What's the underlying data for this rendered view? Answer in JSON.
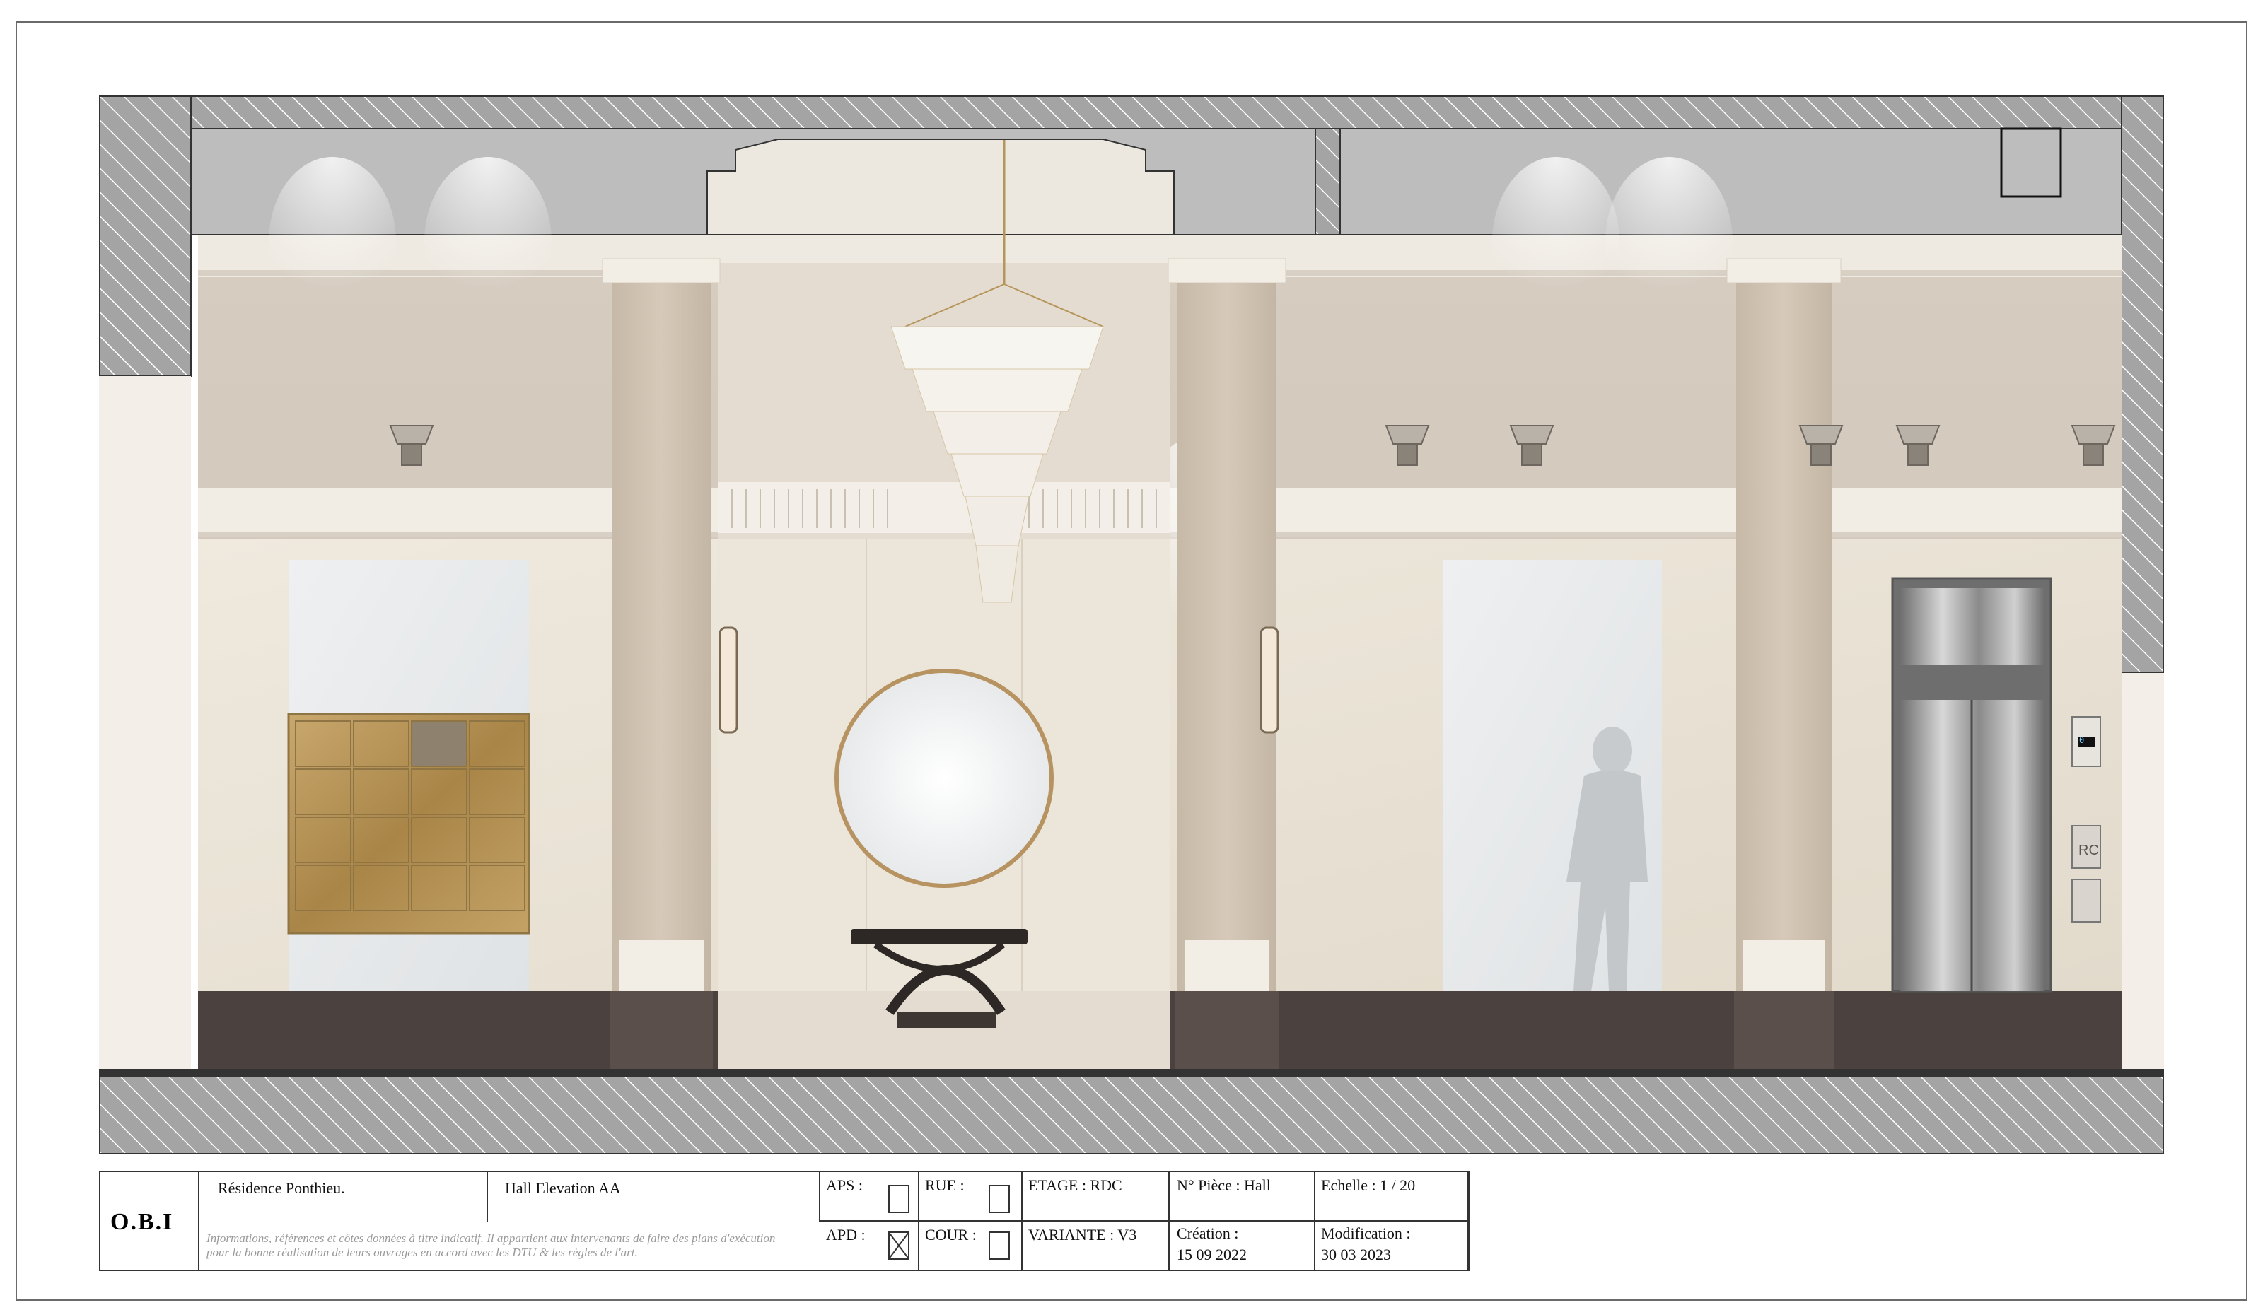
{
  "title_block": {
    "logo": "O.B.I",
    "project": "Résidence Ponthieu.",
    "drawing_name": "Hall Elevation AA",
    "disclaimer": "Informations, références et côtes données à titre indicatif. Il appartient aux  intervenants de faire des plans d'exécution pour la bonne réalisation de leurs ouvrages en accord avec les DTU & les règles de l'art.",
    "aps_label": "APS :",
    "apd_label": "APD :",
    "rue_label": "RUE :",
    "cour_label": "COUR :",
    "etage": "ETAGE : RDC",
    "variante": "VARIANTE : V3",
    "piece": "N° Pièce : Hall",
    "creation_label": "Création :",
    "creation_date": "15 09 2022",
    "echelle": "Echelle : 1 / 20",
    "modification_label": "Modification :",
    "modification_date": "30 03 2023",
    "apd_checked": true,
    "aps_checked": false,
    "rue_checked": false,
    "cour_checked": false
  },
  "elevation": {
    "elevator_floor_display": "0",
    "elevator_panel_label": "RC"
  },
  "colors": {
    "wall_beige": "#d9cfc3",
    "marble": "#ece6da",
    "dark_marble": "#4a403d",
    "hatch_grey": "#9a9a9a",
    "brass": "#b8955a",
    "ceiling_grey": "#b9b9b9"
  }
}
